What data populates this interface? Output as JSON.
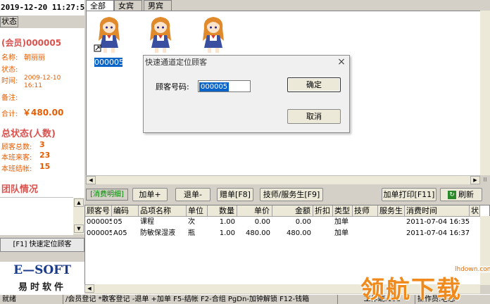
{
  "clock": "2019-12-20  11:27:59",
  "left": {
    "tab_status": "状态",
    "member_id_line": "(会员)000005",
    "name_label": "名称:",
    "name_value": "朝丽丽",
    "state_label": "状态:",
    "time_label": "时间:",
    "time_value_1": "2009-12-10",
    "time_value_2": "16:11",
    "remark_label": "备注:",
    "total_label": "合计:",
    "total_value": "￥480.00",
    "summary_title": "总状态(人数)",
    "customers_total_label": "顾客总数:",
    "customers_total_value": "3",
    "shift_arrived_label": "本班来客:",
    "shift_arrived_value": "23",
    "shift_closed_label": "本班结帐:",
    "shift_closed_value": "15",
    "team_title": "团队情况",
    "quick_locate": "[F1] 快速定位顾客",
    "logo_brand": "E—SOFT",
    "logo_name": "易时软件"
  },
  "tabs": [
    {
      "label": "全部"
    },
    {
      "label": "女宾"
    },
    {
      "label": "男宾"
    }
  ],
  "card_label": "000005",
  "dialog": {
    "title": "快速通道定位顾客",
    "close_glyph": "×",
    "field_label": "顾客号码:",
    "field_value": "000005",
    "ok": "确定",
    "cancel": "取消"
  },
  "toolbar": {
    "detail_label": "[消费明细]",
    "add_single": "加单+",
    "return_single": "退单-",
    "gift_single": "赠单[F8]",
    "technician": "技师/服务生[F9]",
    "add_print": "加单打印[F11]",
    "refresh": "刷新"
  },
  "table": {
    "columns": [
      "顾客号",
      "编码",
      "品项名称",
      "单位",
      "数量",
      "单价",
      "金额",
      "折扣",
      "类型",
      "技师",
      "服务生",
      "消费时间",
      "状"
    ],
    "rows": [
      [
        "000005",
        "05",
        "课程",
        "次",
        "1.00",
        "0.00",
        "0.00",
        "",
        "加单",
        "",
        "",
        "2011-07-04 16:35",
        ""
      ],
      [
        "000005",
        "A05",
        "防敏保湿液",
        "瓶",
        "1.00",
        "480.00",
        "480.00",
        "",
        "加单",
        "",
        "",
        "2011-07-04 16:37",
        ""
      ]
    ]
  },
  "status": {
    "ready": "就绪",
    "hint": "/会员登记 *散客登记 -退单 +加单 F5-结帐 F2-合组 PgDn-加钟解锁 F12-钱箱",
    "terminal": "工作端:101",
    "operator": "操作员:老总"
  },
  "watermark": {
    "text": "领航下载",
    "url": "lhdown.com"
  }
}
